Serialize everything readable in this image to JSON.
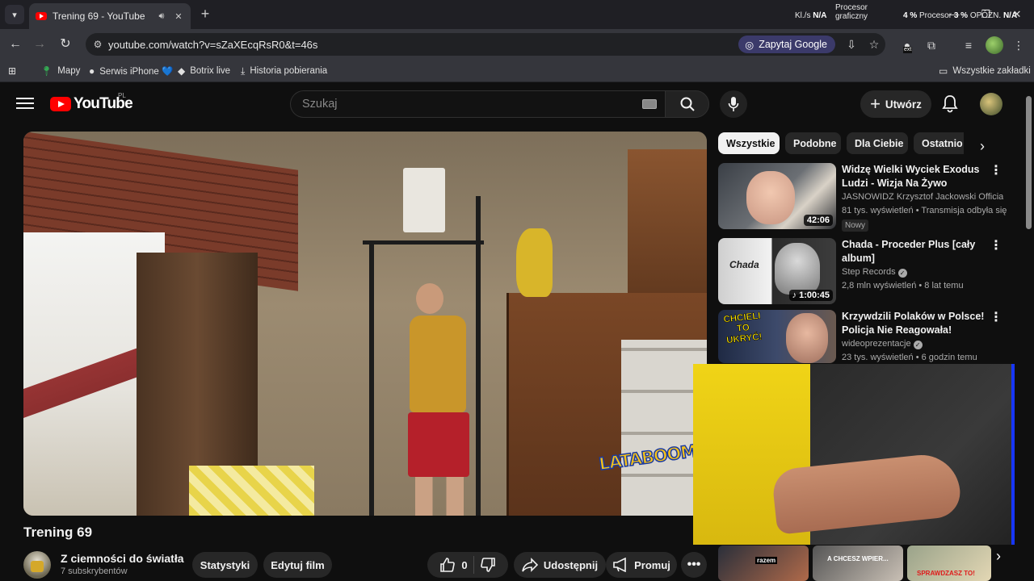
{
  "browser": {
    "tab_title": "Trening 69 - YouTube",
    "url": "youtube.com/watch?v=sZaXEcqRsR0&t=46s",
    "ask_google": "Zapytaj Google",
    "ext_label": "ext",
    "perf": {
      "kls_label": "Kl./s",
      "kls_value": "N/A",
      "gpu_label_1": "Procesor",
      "gpu_label_2": "graficzny",
      "cpu_value": "4 %",
      "cpu_label": "Procesor",
      "delay_value": "3 %",
      "delay_label": "OPÓŹN.",
      "delay_na": "N/A"
    },
    "bookmarks": [
      {
        "label": "Mapy",
        "icon": "map-pin-icon"
      },
      {
        "label": "Serwis iPhone 💙",
        "icon": "apple-icon"
      },
      {
        "label": "Botrix live",
        "icon": "botrix-icon"
      },
      {
        "label": "Historia pobierania",
        "icon": "download-icon"
      }
    ],
    "all_bookmarks": "Wszystkie zakładki"
  },
  "youtube": {
    "logo_text": "YouTube",
    "country": "PL",
    "search_placeholder": "Szukaj",
    "create_label": "Utwórz"
  },
  "video": {
    "title": "Trening 69",
    "watermark": "LATABOOM",
    "channel_name": "Z ciemności do światła",
    "subscribers": "7 subskrybentów",
    "stats_button": "Statystyki",
    "edit_button": "Edytuj film",
    "likes": "0",
    "share_label": "Udostępnij",
    "promote_label": "Promuj"
  },
  "chips": [
    "Wszystkie",
    "Podobne",
    "Dla Ciebie",
    "Ostatnio przesłane"
  ],
  "recommendations": [
    {
      "title": "Widzę Wielki Wyciek Exodus Ludzi - Wizja Na Żywo",
      "channel": "JASNOWIDZ Krzysztof Jackowski Official",
      "meta": "81 tys. wyświetleń • Transmisja odbyła się",
      "duration": "42:06",
      "badge": "Nowy"
    },
    {
      "title": "Chada - Proceder Plus [cały album]",
      "channel": "Step Records",
      "meta": "2,8 mln wyświetleń • 8 lat temu",
      "duration": "1:00:45",
      "thumb_text": "Chada"
    },
    {
      "title": "Krzywdzili Polaków w Polsce! Policja Nie Reagowała! Wpadli...",
      "channel": "wideoprezentacje",
      "meta": "23 tys. wyświetleń • 6 godzin temu",
      "thumb_text_1": "CHCIELI",
      "thumb_text_2": "TO",
      "thumb_text_3": "UKRYĆ!"
    }
  ],
  "bottom_thumbs": {
    "t1": "razem",
    "t2": "A CHCESZ WPIER...",
    "t3": "SPRAWDZASZ TO!"
  },
  "colors": {
    "accent_red": "#ff0000",
    "bg": "#0f0f0f",
    "chip_bg": "#272727",
    "omnibox_chip": "#3b3a6a"
  }
}
